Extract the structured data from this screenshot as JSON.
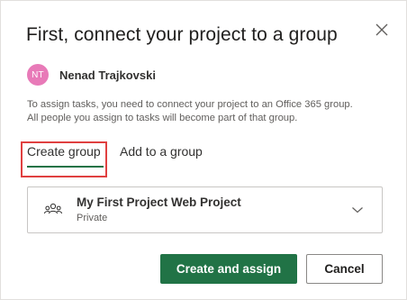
{
  "dialog": {
    "title": "First, connect your project to a group",
    "close_icon": "close-icon"
  },
  "user": {
    "initials": "NT",
    "name": "Nenad Trajkovski",
    "avatar_color": "#e87ab8"
  },
  "description": {
    "line1": "To assign tasks, you need to connect your project to an Office 365 group.",
    "line2": "All people you assign to tasks will become part of that group."
  },
  "tabs": [
    {
      "label": "Create group",
      "selected": true
    },
    {
      "label": "Add to a group",
      "selected": false
    }
  ],
  "group": {
    "name": "My First Project Web Project",
    "privacy": "Private",
    "icon": "people-icon",
    "dropdown_icon": "chevron-down-icon"
  },
  "actions": {
    "primary_label": "Create and assign",
    "secondary_label": "Cancel"
  },
  "colors": {
    "accent": "#217346",
    "highlight_box": "#e04040"
  }
}
